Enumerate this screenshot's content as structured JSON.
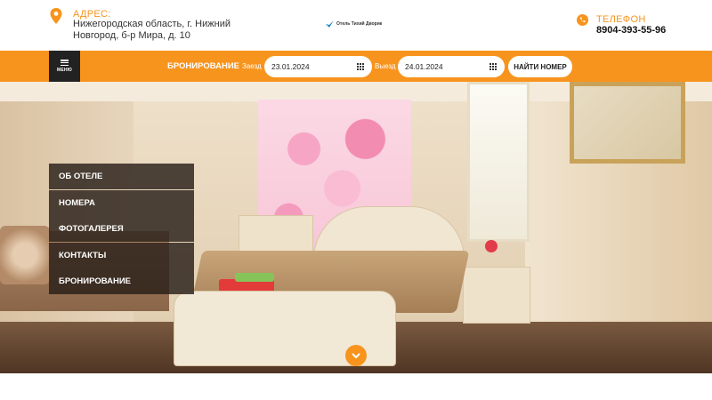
{
  "header": {
    "address_title": "АДРЕС:",
    "address_text": "Нижегородская область, г. Нижний Новгород, б-р Мира, д. 10",
    "logo_text": "Отель Тихий Дворик",
    "phone_title": "ТЕЛЕФОН",
    "phone_number": "8904-393-55-96"
  },
  "booking_bar": {
    "menu_label": "МЕНЮ",
    "booking_label": "БРОНИРОВАНИЕ",
    "checkin_label": "Заезд",
    "checkin_value": "23.01.2024",
    "checkout_label": "Выезд",
    "checkout_value": "24.01.2024",
    "find_button": "НАЙТИ НОМЕР"
  },
  "side_nav": {
    "items": [
      {
        "label": "ОБ ОТЕЛЕ"
      },
      {
        "label": "НОМЕРА"
      },
      {
        "label": "ФОТОГАЛЕРЕЯ"
      },
      {
        "label": "КОНТАКТЫ"
      },
      {
        "label": "БРОНИРОВАНИЕ"
      }
    ]
  },
  "colors": {
    "accent": "#f7941d",
    "dark": "#222222"
  },
  "icons": {
    "address": "map-pin-icon",
    "phone": "phone-icon",
    "menu": "hamburger-icon",
    "calendar": "calendar-icon",
    "scroll": "chevron-down-icon"
  }
}
